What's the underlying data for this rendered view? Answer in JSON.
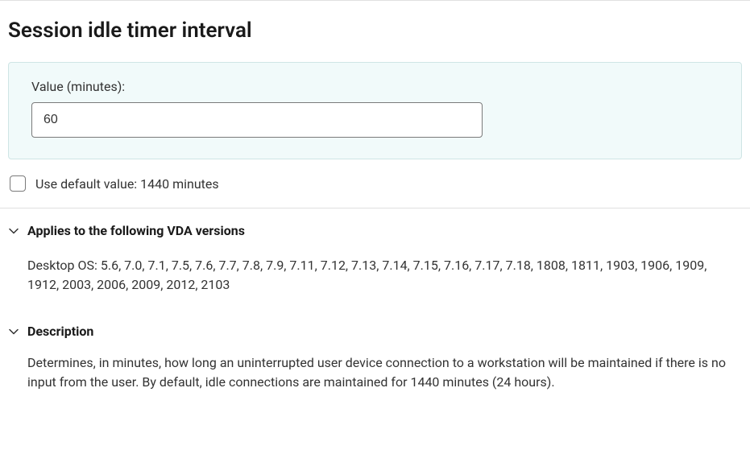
{
  "title": "Session idle timer interval",
  "valuePanel": {
    "label": "Value (minutes):",
    "value": "60"
  },
  "defaultCheckbox": {
    "checked": false,
    "label": "Use default value: 1440 minutes"
  },
  "sections": {
    "vdaVersions": {
      "title": "Applies to the following VDA versions",
      "body": "Desktop OS: 5.6, 7.0, 7.1, 7.5, 7.6, 7.7, 7.8, 7.9, 7.11, 7.12, 7.13, 7.14, 7.15, 7.16, 7.17, 7.18, 1808, 1811, 1903, 1906, 1909, 1912, 2003, 2006, 2009, 2012, 2103"
    },
    "description": {
      "title": "Description",
      "body": "Determines, in minutes, how long an uninterrupted user device connection to a workstation will be maintained if there is no input from the user. By default, idle connections are maintained for 1440 minutes (24 hours)."
    }
  }
}
